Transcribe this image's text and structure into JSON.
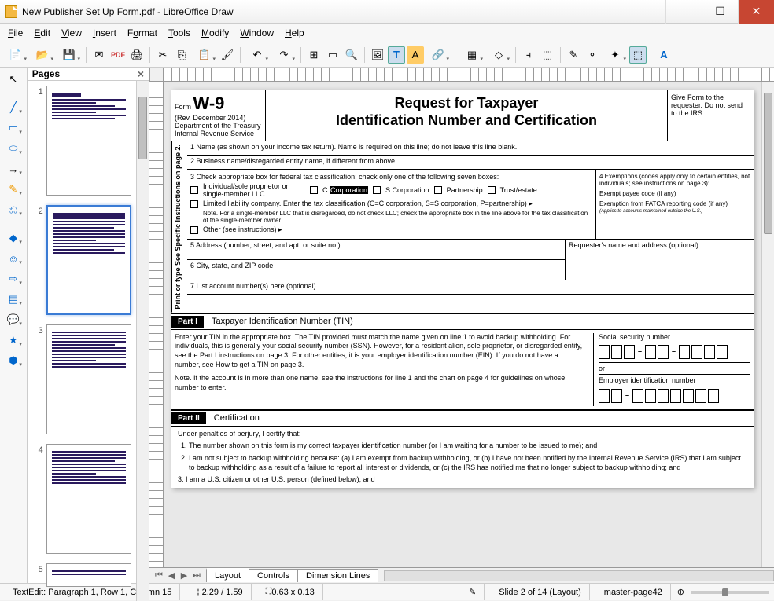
{
  "window": {
    "title": "New Publisher Set Up Form.pdf - LibreOffice Draw"
  },
  "menu": {
    "file": "File",
    "edit": "Edit",
    "view": "View",
    "insert": "Insert",
    "format": "Format",
    "tools": "Tools",
    "modify": "Modify",
    "window": "Window",
    "help": "Help"
  },
  "pages_panel": {
    "title": "Pages"
  },
  "tabs": {
    "layout": "Layout",
    "controls": "Controls",
    "dimension": "Dimension Lines"
  },
  "status": {
    "textedit": "TextEdit: Paragraph 1, Row 1, Column 15",
    "pos": "2.29 / 1.59",
    "size": "0.63 x 0.13",
    "slide": "Slide 2 of 14 (Layout)",
    "master": "master-page42"
  },
  "w9": {
    "form_label": "Form",
    "form_name": "W-9",
    "rev": "(Rev. December 2014)",
    "dept": "Department of the Treasury",
    "irs": "Internal Revenue Service",
    "title_l1": "Request for Taxpayer",
    "title_l2": "Identification Number and Certification",
    "giveform": "Give Form to the requester. Do not send to the IRS",
    "rotate": "Print or type   See Specific Instructions on page 2.",
    "line1": "1  Name (as shown on your income tax return). Name is required on this line; do not leave this line blank.",
    "line2": "2  Business name/disregarded entity name, if different from above",
    "line3_hdr": "3  Check appropriate box for federal tax classification; check only one of the following seven boxes:",
    "chk_indiv": "Individual/sole proprietor or single-member LLC",
    "chk_ccorp_pre": "C ",
    "chk_ccorp_sel": "Corporation",
    "chk_scorp": "S Corporation",
    "chk_partner": "Partnership",
    "chk_trust": "Trust/estate",
    "chk_llc": "Limited liability company. Enter the tax classification (C=C corporation, S=S corporation, P=partnership) ▸",
    "llc_note": "Note. For a single-member LLC that is disregarded, do not check LLC; check the appropriate box in the line above for the tax classification of the single-member owner.",
    "chk_other": "Other (see instructions) ▸",
    "line4_hdr": "4  Exemptions (codes apply only to certain entities, not individuals; see instructions on page 3):",
    "exempt1": "Exempt payee code (if any)",
    "exempt2": "Exemption from FATCA reporting code (if any)",
    "exempt3": "(Applies to accounts maintained outside the U.S.)",
    "line5": "5  Address (number, street, and apt. or suite no.)",
    "line6": "6  City, state, and ZIP code",
    "line7": "7  List account number(s) here (optional)",
    "requester": "Requester's name and address (optional)",
    "part1_label": "Part I",
    "part1_title": "Taxpayer Identification Number (TIN)",
    "part1_text1": "Enter your TIN in the appropriate box. The TIN provided must match the name given on line 1 to avoid backup withholding. For individuals, this is generally your social security number (SSN). However, for a resident alien, sole proprietor, or disregarded entity, see the Part I instructions on page 3. For other entities, it is your employer identification number (EIN). If you do not have a number, see How to get a TIN on page 3.",
    "part1_text2": "Note. If the account is in more than one name, see the instructions for line 1 and the chart on page 4 for guidelines on whose number to enter.",
    "ssn_label": "Social security number",
    "or": "or",
    "ein_label": "Employer identification number",
    "part2_label": "Part II",
    "part2_title": "Certification",
    "cert_intro": "Under penalties of perjury, I certify that:",
    "cert1": "The number shown on this form is my correct taxpayer identification number (or I am waiting for a number to be issued to me); and",
    "cert2": "I am not subject to backup withholding because: (a) I am exempt from backup withholding, or (b) I have not been notified by the Internal Revenue Service (IRS) that I am subject to backup withholding as a result of a failure to report all interest or dividends, or (c) the IRS has notified me that no longer subject to backup withholding; and",
    "cert3": "I am a U.S. citizen or other U.S. person (defined below); and"
  }
}
